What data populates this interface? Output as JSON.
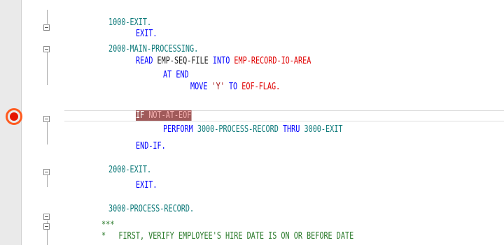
{
  "editor": {
    "lines": [
      {
        "key": "l1",
        "tokens": [
          {
            "t": "1000-EXIT.",
            "c": "lbl"
          }
        ]
      },
      {
        "key": "l2",
        "tokens": [
          {
            "t": "EXIT.",
            "c": "kw"
          }
        ]
      },
      {
        "key": "l3",
        "tokens": [
          {
            "t": "2000-MAIN-PROCESSING.",
            "c": "lbl"
          }
        ]
      },
      {
        "key": "l4",
        "tokens": [
          {
            "t": "READ ",
            "c": "kw"
          },
          {
            "t": "EMP-SEQ-FILE ",
            "c": "id"
          },
          {
            "t": "INTO ",
            "c": "kw"
          },
          {
            "t": "EMP-RECORD-IO-AREA",
            "c": "var"
          }
        ]
      },
      {
        "key": "l5",
        "tokens": [
          {
            "t": "AT END",
            "c": "kw"
          }
        ]
      },
      {
        "key": "l6",
        "tokens": [
          {
            "t": "MOVE ",
            "c": "kw"
          },
          {
            "t": "'Y' ",
            "c": "str"
          },
          {
            "t": "TO ",
            "c": "kw"
          },
          {
            "t": "EOF-FLAG.",
            "c": "var"
          }
        ]
      },
      {
        "key": "l7",
        "tokens": [
          {
            "t": "IF ",
            "c": "hl"
          },
          {
            "t": "NOT-AT-EOF",
            "c": "hl-var"
          }
        ]
      },
      {
        "key": "l8",
        "tokens": [
          {
            "t": "PERFORM ",
            "c": "kw"
          },
          {
            "t": "3000-PROCESS-RECORD ",
            "c": "lbl"
          },
          {
            "t": "THRU ",
            "c": "kw"
          },
          {
            "t": "3000-EXIT",
            "c": "lbl"
          }
        ]
      },
      {
        "key": "l9",
        "tokens": [
          {
            "t": "END-IF.",
            "c": "kw"
          }
        ]
      },
      {
        "key": "l10",
        "tokens": [
          {
            "t": "2000-EXIT.",
            "c": "lbl"
          }
        ]
      },
      {
        "key": "l11",
        "tokens": [
          {
            "t": "EXIT.",
            "c": "kw"
          }
        ]
      },
      {
        "key": "l12",
        "tokens": [
          {
            "t": "3000-PROCESS-RECORD.",
            "c": "lbl"
          }
        ]
      },
      {
        "key": "l13",
        "tokens": [
          {
            "t": "***",
            "c": "cmt"
          }
        ]
      },
      {
        "key": "l14",
        "tokens": [
          {
            "t": "*   FIRST, VERIFY EMPLOYEE'S HIRE DATE IS ON OR BEFORE DATE",
            "c": "cmt"
          }
        ]
      }
    ]
  },
  "gutter": {
    "breakpoint_icon": "breakpoint-icon",
    "fold_icon": "collapse-icon",
    "breakpoint_color": "#e51400",
    "breakpoint_ring_color": "#ff5a1e"
  }
}
